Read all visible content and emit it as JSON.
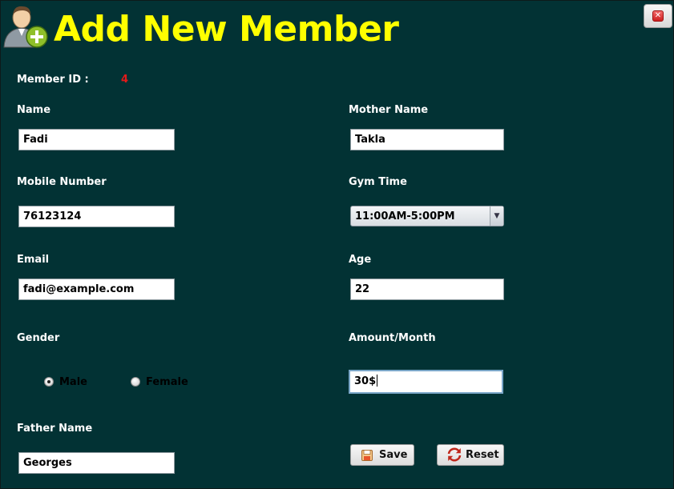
{
  "window": {
    "title": "Add New Member",
    "close_icon": "close-icon"
  },
  "form": {
    "member_id_label": "Member ID :",
    "member_id_value": "4",
    "name_label": "Name",
    "name_value": "Fadi",
    "mother_name_label": "Mother Name",
    "mother_name_value": "Takla",
    "mobile_label": "Mobile Number",
    "mobile_value": "76123124",
    "gym_time_label": "Gym Time",
    "gym_time_value": "11:00AM-5:00PM",
    "email_label": "Email",
    "email_value": "fadi@example.com",
    "age_label": "Age",
    "age_value": "22",
    "gender_label": "Gender",
    "gender_options": [
      "Male",
      "Female"
    ],
    "gender_selected": "Male",
    "amount_label": "Amount/Month",
    "amount_value": "30$",
    "father_name_label": "Father Name",
    "father_name_value": "Georges"
  },
  "buttons": {
    "save_label": "Save",
    "reset_label": "Reset"
  },
  "colors": {
    "background": "#023234",
    "title": "#ffff00",
    "label": "#ffffff",
    "member_id_value": "#e21a1a"
  }
}
